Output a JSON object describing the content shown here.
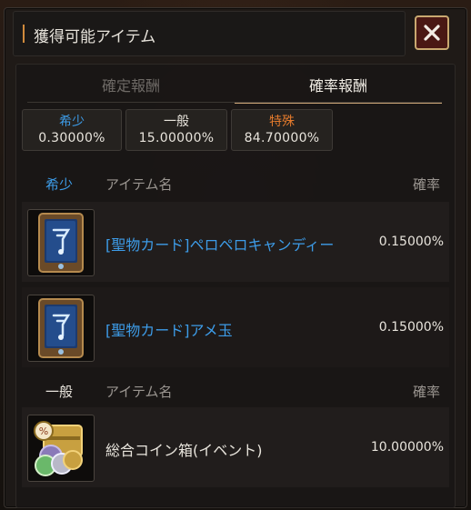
{
  "header": {
    "title": "獲得可能アイテム",
    "close_icon": "close-icon"
  },
  "tabs": [
    {
      "label": "確定報酬",
      "active": false
    },
    {
      "label": "確率報酬",
      "active": true
    }
  ],
  "summary": {
    "rare": {
      "label": "希少",
      "value": "0.30000%"
    },
    "normal": {
      "label": "一般",
      "value": "15.00000%"
    },
    "special": {
      "label": "特殊",
      "value": "84.70000%"
    }
  },
  "sections": [
    {
      "category": "希少",
      "name_header": "アイテム名",
      "rate_header": "確率",
      "items": [
        {
          "name": "[聖物カード]ペロペロキャンディー",
          "rate": "0.15000%",
          "icon": "relic-card-icon"
        },
        {
          "name": "[聖物カード]アメ玉",
          "rate": "0.15000%",
          "icon": "relic-card-icon"
        }
      ]
    },
    {
      "category": "一般",
      "name_header": "アイテム名",
      "rate_header": "確率",
      "items": [
        {
          "name": "総合コイン箱(イベント)",
          "rate": "10.00000%",
          "icon": "coin-box-icon"
        }
      ]
    }
  ],
  "colors": {
    "accent_blue": "#3d9ce8",
    "accent_orange": "#e37a2c",
    "close_bg": "#4a1814",
    "close_border": "#c9a870"
  }
}
